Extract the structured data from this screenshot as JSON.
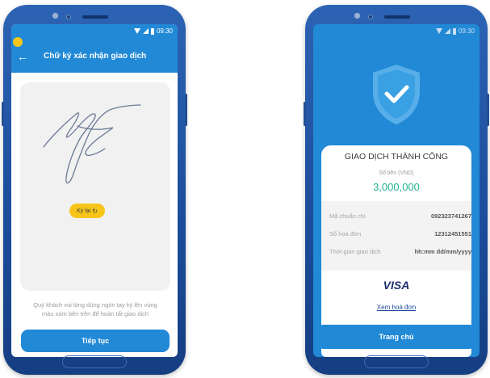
{
  "status_bar": {
    "time": "09:30"
  },
  "signature_screen": {
    "title": "Chữ ký xác nhận giao dịch",
    "retry_label": "Ký lại",
    "hint_line1": "Quý khách vui lòng dùng ngón tay ký lên vùng",
    "hint_line2": "màu xám bên trên để hoàn tất giao dịch",
    "continue_label": "Tiếp tục"
  },
  "success_screen": {
    "title": "GIAO DỊCH THÀNH CÔNG",
    "amount_label": "Số tiền (VND)",
    "amount": "3,000,000",
    "details": [
      {
        "label": "Mã chuẩn chi",
        "value": "092323741267"
      },
      {
        "label": "Số hoá đơn",
        "value": "12312451551"
      },
      {
        "label": "Thời gian giao dịch",
        "value": "hh:mm dd/mm/yyyy"
      }
    ],
    "card_brand": "VISA",
    "view_bill_label": "Xem hoá đơn",
    "home_label": "Trang chủ"
  },
  "colors": {
    "primary": "#2189d6",
    "accent_yellow": "#f7c51a",
    "success_green": "#23b58e",
    "phone_body": "#1b4c9a"
  },
  "icons": [
    "back-arrow-icon",
    "refresh-icon",
    "shield-check-icon",
    "wifi-icon",
    "signal-icon",
    "battery-icon"
  ]
}
